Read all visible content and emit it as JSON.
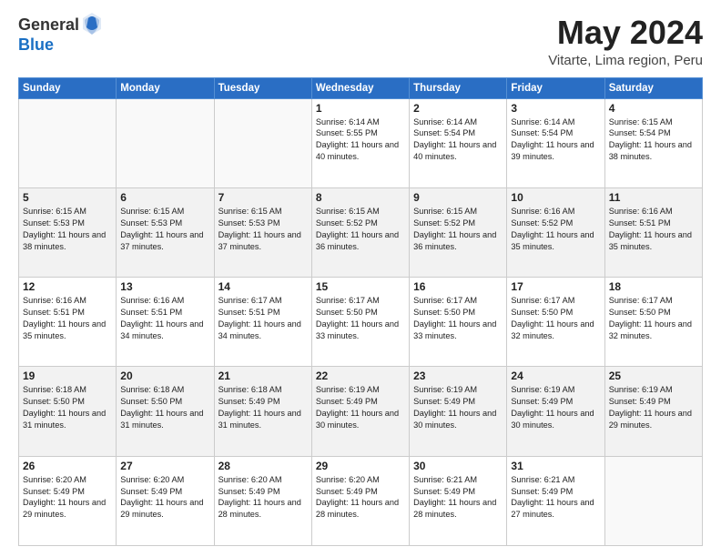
{
  "header": {
    "logo_general": "General",
    "logo_blue": "Blue",
    "month_title": "May 2024",
    "location": "Vitarte, Lima region, Peru"
  },
  "days_of_week": [
    "Sunday",
    "Monday",
    "Tuesday",
    "Wednesday",
    "Thursday",
    "Friday",
    "Saturday"
  ],
  "weeks": [
    [
      {
        "day": "",
        "content": ""
      },
      {
        "day": "",
        "content": ""
      },
      {
        "day": "",
        "content": ""
      },
      {
        "day": "1",
        "content": "Sunrise: 6:14 AM\nSunset: 5:55 PM\nDaylight: 11 hours and 40 minutes."
      },
      {
        "day": "2",
        "content": "Sunrise: 6:14 AM\nSunset: 5:54 PM\nDaylight: 11 hours and 40 minutes."
      },
      {
        "day": "3",
        "content": "Sunrise: 6:14 AM\nSunset: 5:54 PM\nDaylight: 11 hours and 39 minutes."
      },
      {
        "day": "4",
        "content": "Sunrise: 6:15 AM\nSunset: 5:54 PM\nDaylight: 11 hours and 38 minutes."
      }
    ],
    [
      {
        "day": "5",
        "content": "Sunrise: 6:15 AM\nSunset: 5:53 PM\nDaylight: 11 hours and 38 minutes."
      },
      {
        "day": "6",
        "content": "Sunrise: 6:15 AM\nSunset: 5:53 PM\nDaylight: 11 hours and 37 minutes."
      },
      {
        "day": "7",
        "content": "Sunrise: 6:15 AM\nSunset: 5:53 PM\nDaylight: 11 hours and 37 minutes."
      },
      {
        "day": "8",
        "content": "Sunrise: 6:15 AM\nSunset: 5:52 PM\nDaylight: 11 hours and 36 minutes."
      },
      {
        "day": "9",
        "content": "Sunrise: 6:15 AM\nSunset: 5:52 PM\nDaylight: 11 hours and 36 minutes."
      },
      {
        "day": "10",
        "content": "Sunrise: 6:16 AM\nSunset: 5:52 PM\nDaylight: 11 hours and 35 minutes."
      },
      {
        "day": "11",
        "content": "Sunrise: 6:16 AM\nSunset: 5:51 PM\nDaylight: 11 hours and 35 minutes."
      }
    ],
    [
      {
        "day": "12",
        "content": "Sunrise: 6:16 AM\nSunset: 5:51 PM\nDaylight: 11 hours and 35 minutes."
      },
      {
        "day": "13",
        "content": "Sunrise: 6:16 AM\nSunset: 5:51 PM\nDaylight: 11 hours and 34 minutes."
      },
      {
        "day": "14",
        "content": "Sunrise: 6:17 AM\nSunset: 5:51 PM\nDaylight: 11 hours and 34 minutes."
      },
      {
        "day": "15",
        "content": "Sunrise: 6:17 AM\nSunset: 5:50 PM\nDaylight: 11 hours and 33 minutes."
      },
      {
        "day": "16",
        "content": "Sunrise: 6:17 AM\nSunset: 5:50 PM\nDaylight: 11 hours and 33 minutes."
      },
      {
        "day": "17",
        "content": "Sunrise: 6:17 AM\nSunset: 5:50 PM\nDaylight: 11 hours and 32 minutes."
      },
      {
        "day": "18",
        "content": "Sunrise: 6:17 AM\nSunset: 5:50 PM\nDaylight: 11 hours and 32 minutes."
      }
    ],
    [
      {
        "day": "19",
        "content": "Sunrise: 6:18 AM\nSunset: 5:50 PM\nDaylight: 11 hours and 31 minutes."
      },
      {
        "day": "20",
        "content": "Sunrise: 6:18 AM\nSunset: 5:50 PM\nDaylight: 11 hours and 31 minutes."
      },
      {
        "day": "21",
        "content": "Sunrise: 6:18 AM\nSunset: 5:49 PM\nDaylight: 11 hours and 31 minutes."
      },
      {
        "day": "22",
        "content": "Sunrise: 6:19 AM\nSunset: 5:49 PM\nDaylight: 11 hours and 30 minutes."
      },
      {
        "day": "23",
        "content": "Sunrise: 6:19 AM\nSunset: 5:49 PM\nDaylight: 11 hours and 30 minutes."
      },
      {
        "day": "24",
        "content": "Sunrise: 6:19 AM\nSunset: 5:49 PM\nDaylight: 11 hours and 30 minutes."
      },
      {
        "day": "25",
        "content": "Sunrise: 6:19 AM\nSunset: 5:49 PM\nDaylight: 11 hours and 29 minutes."
      }
    ],
    [
      {
        "day": "26",
        "content": "Sunrise: 6:20 AM\nSunset: 5:49 PM\nDaylight: 11 hours and 29 minutes."
      },
      {
        "day": "27",
        "content": "Sunrise: 6:20 AM\nSunset: 5:49 PM\nDaylight: 11 hours and 29 minutes."
      },
      {
        "day": "28",
        "content": "Sunrise: 6:20 AM\nSunset: 5:49 PM\nDaylight: 11 hours and 28 minutes."
      },
      {
        "day": "29",
        "content": "Sunrise: 6:20 AM\nSunset: 5:49 PM\nDaylight: 11 hours and 28 minutes."
      },
      {
        "day": "30",
        "content": "Sunrise: 6:21 AM\nSunset: 5:49 PM\nDaylight: 11 hours and 28 minutes."
      },
      {
        "day": "31",
        "content": "Sunrise: 6:21 AM\nSunset: 5:49 PM\nDaylight: 11 hours and 27 minutes."
      },
      {
        "day": "",
        "content": ""
      }
    ]
  ]
}
